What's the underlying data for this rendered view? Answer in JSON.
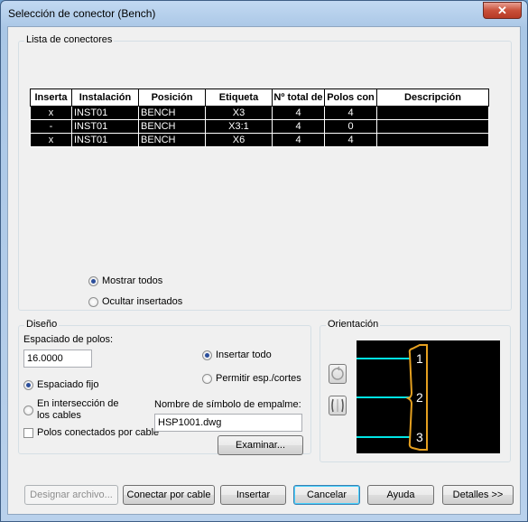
{
  "window": {
    "title": "Selección de conector  (Bench)",
    "close_label": "✕"
  },
  "connector_list": {
    "legend": "Lista de conectores",
    "columns": [
      "Inserta",
      "Instalación",
      "Posición",
      "Etiqueta",
      "Nº total de",
      "Polos con",
      "Descripción"
    ],
    "rows": [
      [
        "x",
        "INST01",
        "BENCH",
        "X3",
        "4",
        "4",
        ""
      ],
      [
        "-",
        "INST01",
        "BENCH",
        "X3:1",
        "4",
        "0",
        ""
      ],
      [
        "x",
        "INST01",
        "BENCH",
        "X6",
        "4",
        "4",
        ""
      ]
    ],
    "show_all": "Mostrar todos",
    "hide_inserted": "Ocultar insertados",
    "selected_filter": "show_all"
  },
  "design": {
    "legend": "Diseño",
    "spacing_label": "Espaciado de polos:",
    "spacing_value": "16.0000",
    "fixed_spacing": "Espaciado fijo",
    "at_intersection": "En intersección de los cables",
    "insert_all": "Insertar todo",
    "allow_gaps": "Permitir esp./cortes",
    "poles_by_cable": "Polos conectados por cable",
    "symbol_label": "Nombre de símbolo de empalme:",
    "symbol_value": "HSP1001.dwg",
    "browse": "Examinar..."
  },
  "orientation": {
    "legend": "Orientación",
    "pins": [
      "1",
      "2",
      "3"
    ],
    "colors": {
      "wire": "#00e5e5",
      "body": "#e5a020"
    }
  },
  "buttons": {
    "designate_file": "Designar archivo...",
    "connect_by_cable": "Conectar por cable",
    "insert": "Insertar",
    "cancel": "Cancelar",
    "help": "Ayuda",
    "details": "Detalles >>"
  }
}
